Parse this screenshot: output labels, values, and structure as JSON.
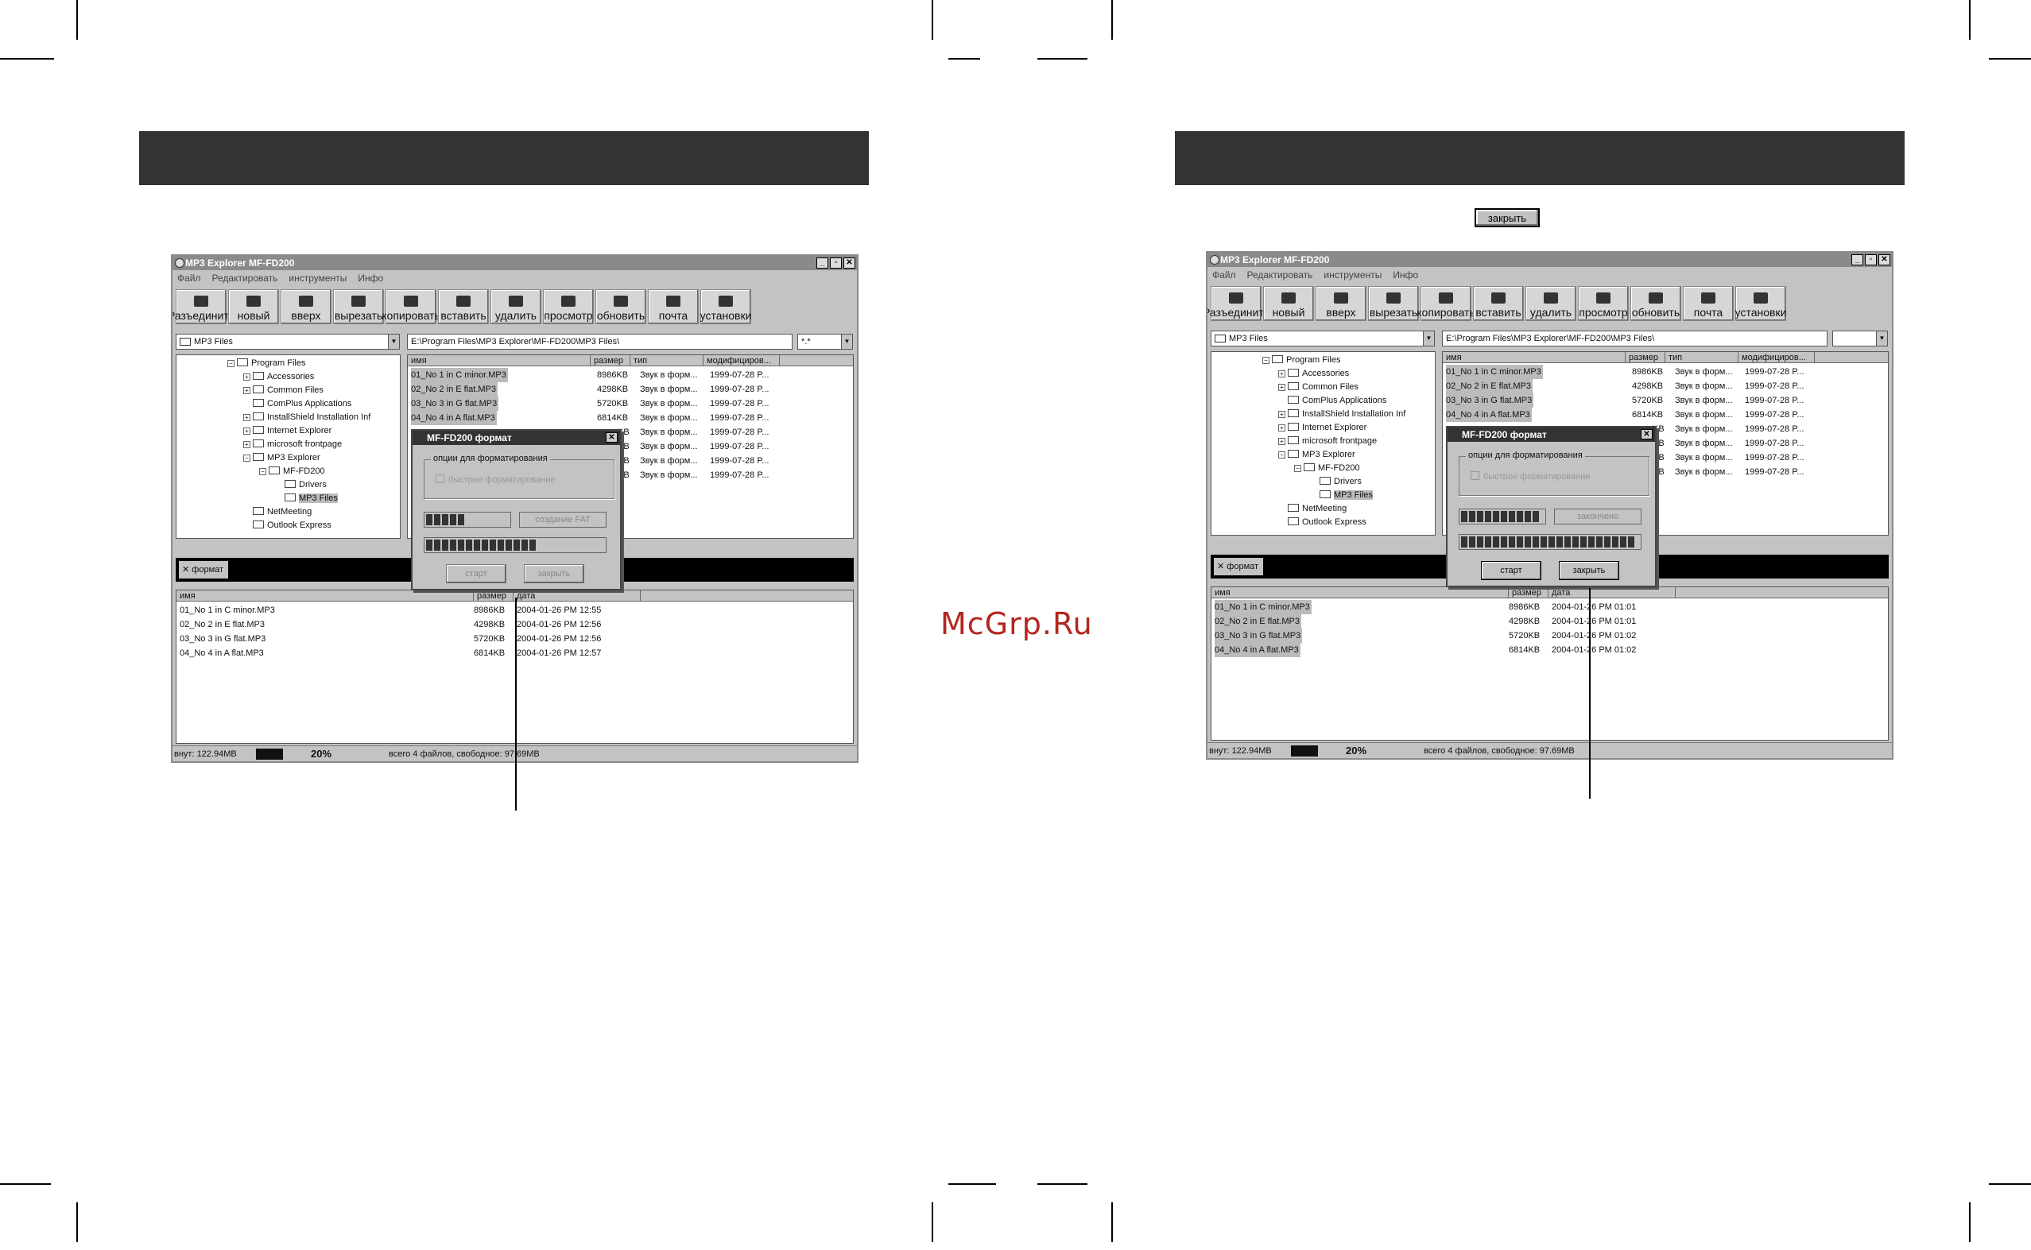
{
  "watermark": "McGrp.Ru",
  "top_close_button": "закрыть",
  "windows": [
    {
      "title": "MP3 Explorer MF-FD200",
      "menu": [
        "Файл",
        "Редактировать",
        "инструменты",
        "Инфо"
      ],
      "toolbar": [
        "Разъединить",
        "новый",
        "вверх",
        "вырезать",
        "копировать",
        "вставить",
        "удалить",
        "просмотр",
        "обновить",
        "почта",
        "установки"
      ],
      "folder_combo": "MP3 Files",
      "path": "E:\\Program Files\\MP3 Explorer\\MF-FD200\\MP3 Files\\",
      "filter": "*.*",
      "tree": [
        "Program Files",
        "Accessories",
        "Common Files",
        "ComPlus Applications",
        "InstallShield Installation Inf",
        "Internet Explorer",
        "microsoft frontpage",
        "MP3 Explorer",
        "MF-FD200",
        "Drivers",
        "MP3 Files",
        "NetMeeting",
        "Outlook Express"
      ],
      "pc_headers": [
        "имя",
        "размер",
        "тип",
        "модифициров..."
      ],
      "pc_files": [
        {
          "name": "01_No 1 in C minor.MP3",
          "size": "8986KB",
          "type": "Звук в форм...",
          "mod": "1999-07-28 P..."
        },
        {
          "name": "02_No 2 in E flat.MP3",
          "size": "4298KB",
          "type": "Звук в форм...",
          "mod": "1999-07-28 P..."
        },
        {
          "name": "03_No 3 in G flat.MP3",
          "size": "5720KB",
          "type": "Звук в форм...",
          "mod": "1999-07-28 P..."
        },
        {
          "name": "04_No 4 in A flat.MP3",
          "size": "6814KB",
          "type": "Звук в форм...",
          "mod": "1999-07-28 P..."
        },
        {
          "name": "",
          "size": "KB",
          "type": "Звук в форм...",
          "mod": "1999-07-28 P..."
        },
        {
          "name": "",
          "size": "KB",
          "type": "Звук в форм...",
          "mod": "1999-07-28 P..."
        },
        {
          "name": "",
          "size": "KB",
          "type": "Звук в форм...",
          "mod": "1999-07-28 P..."
        },
        {
          "name": "",
          "size": "KB",
          "type": "Звук в форм...",
          "mod": "1999-07-28 P..."
        }
      ],
      "format_button": "формат",
      "dev_headers": [
        "имя",
        "размер",
        "дата"
      ],
      "dev_files": [
        {
          "name": "01_No 1 in C minor.MP3",
          "size": "8986KB",
          "date": "2004-01-26 PM 12:55"
        },
        {
          "name": "02_No 2 in E flat.MP3",
          "size": "4298KB",
          "date": "2004-01-26 PM 12:56"
        },
        {
          "name": "03_No 3 in G flat.MP3",
          "size": "5720KB",
          "date": "2004-01-26 PM 12:56"
        },
        {
          "name": "04_No 4 in A flat.MP3",
          "size": "6814KB",
          "date": "2004-01-26 PM 12:57"
        }
      ],
      "status_capacity": "внут: 122.94MB",
      "status_percent": "20%",
      "status_info": "всего 4 файлов, свободное: 97.69MB",
      "dialog": {
        "title": "MF-FD200 формат",
        "group_label": "опции для форматирования",
        "checkbox": "быстрое форматирование",
        "state": "создание FAT",
        "bar1_fraction": 0.5,
        "bar2_fraction": 0.65,
        "start": "старт",
        "close": "закрыть"
      }
    },
    {
      "title": "MP3 Explorer MF-FD200",
      "menu": [
        "Файл",
        "Редактировать",
        "инструменты",
        "Инфо"
      ],
      "toolbar": [
        "Разъединить",
        "новый",
        "вверх",
        "вырезать",
        "копировать",
        "вставить",
        "удалить",
        "просмотр",
        "обновить",
        "почта",
        "установки"
      ],
      "folder_combo": "MP3 Files",
      "path": "E:\\Program Files\\MP3 Explorer\\MF-FD200\\MP3 Files\\",
      "filter": "",
      "tree": [
        "Program Files",
        "Accessories",
        "Common Files",
        "ComPlus Applications",
        "InstallShield Installation Inf",
        "Internet Explorer",
        "microsoft frontpage",
        "MP3 Explorer",
        "MF-FD200",
        "Drivers",
        "MP3 Files",
        "NetMeeting",
        "Outlook Express"
      ],
      "pc_headers": [
        "имя",
        "размер",
        "тип",
        "модифициров..."
      ],
      "pc_files": [
        {
          "name": "01_No 1 in C minor.MP3",
          "size": "8986KB",
          "type": "Звук в форм...",
          "mod": "1999-07-28 P..."
        },
        {
          "name": "02_No 2 in E flat.MP3",
          "size": "4298KB",
          "type": "Звук в форм...",
          "mod": "1999-07-28 P..."
        },
        {
          "name": "03_No 3 in G flat.MP3",
          "size": "5720KB",
          "type": "Звук в форм...",
          "mod": "1999-07-28 P..."
        },
        {
          "name": "04_No 4 in A flat.MP3",
          "size": "6814KB",
          "type": "Звук в форм...",
          "mod": "1999-07-28 P..."
        },
        {
          "name": "",
          "size": "KB",
          "type": "Звук в форм...",
          "mod": "1999-07-28 P..."
        },
        {
          "name": "",
          "size": "KB",
          "type": "Звук в форм...",
          "mod": "1999-07-28 P..."
        },
        {
          "name": "",
          "size": "KB",
          "type": "Звук в форм...",
          "mod": "1999-07-28 P..."
        },
        {
          "name": "",
          "size": "KB",
          "type": "Звук в форм...",
          "mod": "1999-07-28 P..."
        }
      ],
      "format_button": "формат",
      "dev_headers": [
        "имя",
        "размер",
        "дата"
      ],
      "dev_files": [
        {
          "name": "01_No 1 in C minor.MP3",
          "size": "8986KB",
          "date": "2004-01-26 PM 01:01"
        },
        {
          "name": "02_No 2 in E flat.MP3",
          "size": "4298KB",
          "date": "2004-01-26 PM 01:01"
        },
        {
          "name": "03_No 3 in G flat.MP3",
          "size": "5720KB",
          "date": "2004-01-26 PM 01:02"
        },
        {
          "name": "04_No 4 in A flat.MP3",
          "size": "6814KB",
          "date": "2004-01-26 PM 01:02"
        }
      ],
      "status_capacity": "внут: 122.94MB",
      "status_percent": "20%",
      "status_info": "всего 4 файлов, свободное: 97.69MB",
      "dialog": {
        "title": "MF-FD200 формат",
        "group_label": "опции для форматирования",
        "checkbox": "быстрое форматирование",
        "state": "закончено",
        "bar1_fraction": 1.0,
        "bar2_fraction": 1.0,
        "start": "старт",
        "close": "закрыть"
      }
    }
  ]
}
